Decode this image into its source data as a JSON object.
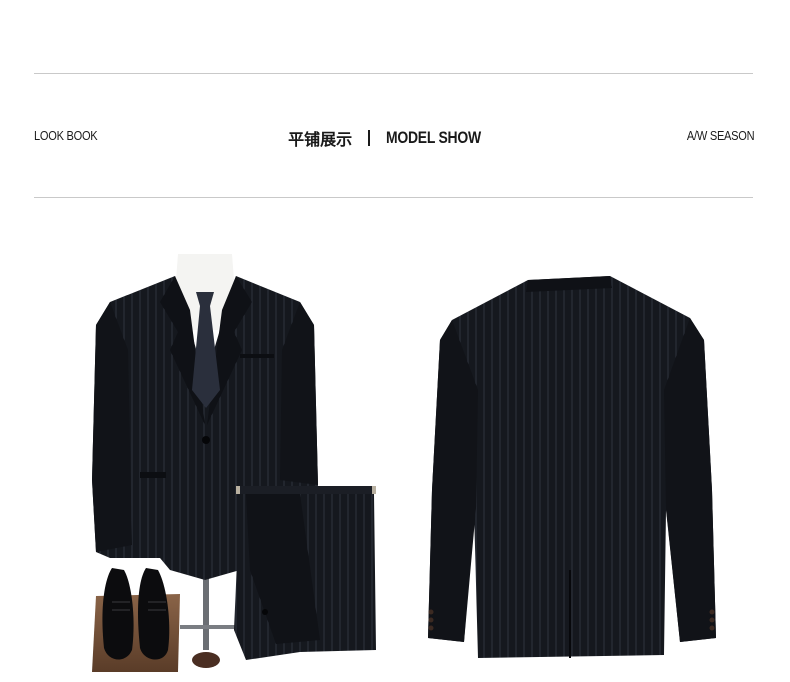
{
  "header": {
    "left_label": "LOOK BOOK",
    "title_cn": "平铺展示",
    "title_en": "MODEL SHOW",
    "right_label": "A/W SEASON"
  },
  "colors": {
    "rule": "#c9c9c9",
    "suit": "#15181e",
    "shirt": "#f4f4f2",
    "tie": "#2a2f3c",
    "base_wood": "#6e4c36"
  }
}
